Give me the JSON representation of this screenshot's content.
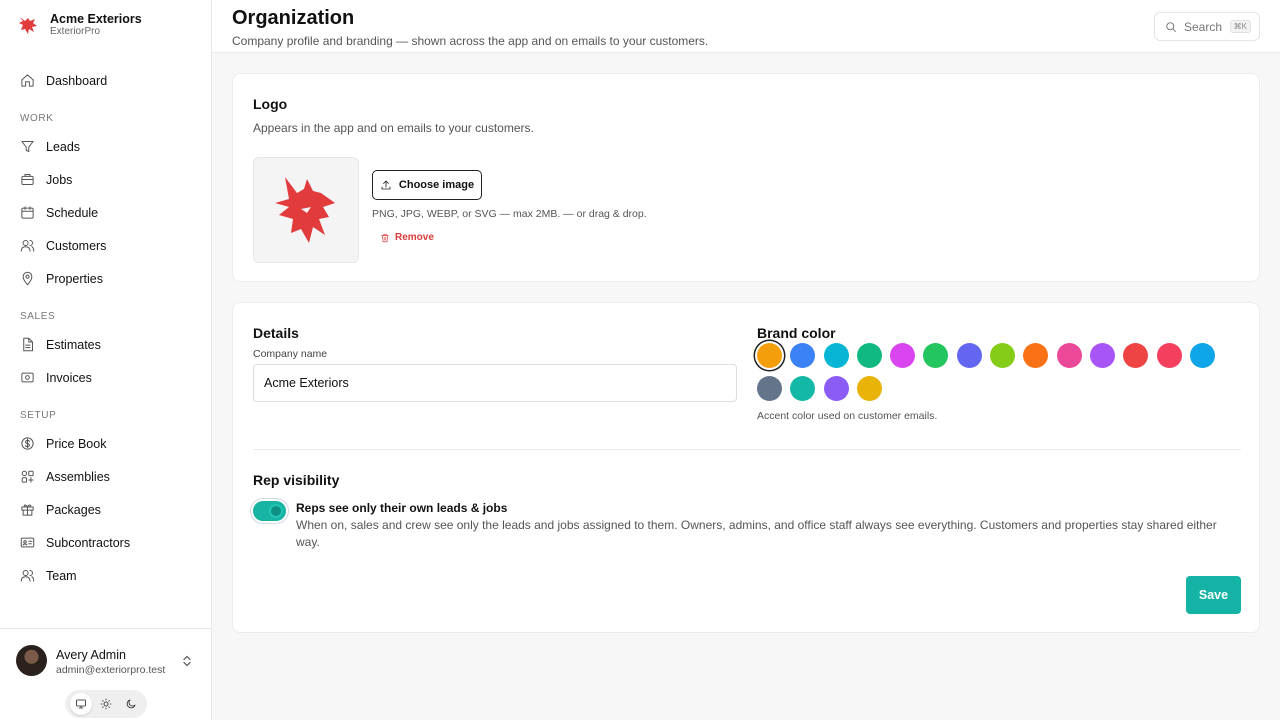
{
  "brand": {
    "name": "Acme Exteriors",
    "sub": "ExteriorPro",
    "color": "#e23b3b"
  },
  "nav": {
    "dashboard": "Dashboard",
    "section_work": "WORK",
    "leads": "Leads",
    "jobs": "Jobs",
    "schedule": "Schedule",
    "customers": "Customers",
    "properties": "Properties",
    "section_sales": "SALES",
    "estimates": "Estimates",
    "invoices": "Invoices",
    "section_setup": "SETUP",
    "price_book": "Price Book",
    "assemblies": "Assemblies",
    "packages": "Packages",
    "subcontractors": "Subcontractors",
    "team": "Team"
  },
  "user": {
    "name": "Avery Admin",
    "email": "admin@exteriorpro.test"
  },
  "theme": {
    "selected": "system",
    "icons": [
      "monitor-icon",
      "sun-icon",
      "moon-icon"
    ]
  },
  "header": {
    "title": "Organization",
    "subtitle": "Company profile and branding — shown across the app and on emails to your customers.",
    "search_label": "Search",
    "search_shortcut": "⌘K"
  },
  "logo_card": {
    "title": "Logo",
    "description": "Appears in the app and on emails to your customers.",
    "choose_label": "Choose image",
    "hint": "PNG, JPG, WEBP, or SVG — max 2MB. — or drag & drop.",
    "remove_label": "Remove"
  },
  "details": {
    "title": "Details",
    "company_label": "Company name",
    "company_value": "Acme Exteriors"
  },
  "brand_color": {
    "title": "Brand color",
    "note": "Accent color used on customer emails.",
    "selected_index": 0,
    "colors": [
      "#f59e0b",
      "#3b82f6",
      "#06b6d4",
      "#10b981",
      "#d946ef",
      "#22c55e",
      "#6366f1",
      "#84cc16",
      "#f97316",
      "#ec4899",
      "#a855f7",
      "#ef4444",
      "#f43f5e",
      "#0ea5e9",
      "#64748b",
      "#14b8a6",
      "#8b5cf6",
      "#eab308"
    ]
  },
  "rep_visibility": {
    "title": "Rep visibility",
    "toggle_on": true,
    "toggle_label": "Reps see only their own leads & jobs",
    "description": "When on, sales and crew see only the leads and jobs assigned to them. Owners, admins, and office staff always see everything. Customers and properties stay shared either way."
  },
  "save_label": "Save",
  "accent_color": "#14b3a5"
}
